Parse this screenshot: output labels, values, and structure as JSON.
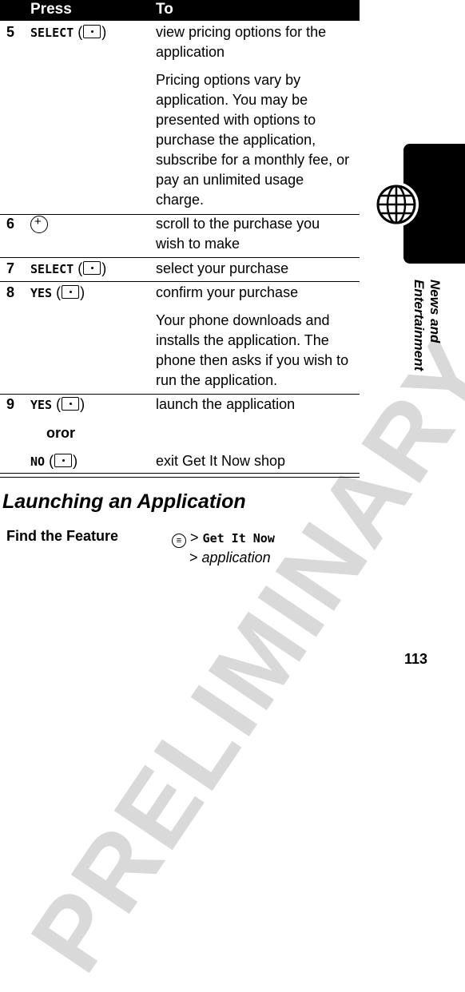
{
  "watermark": "PRELIMINARY",
  "table": {
    "headers": {
      "press": "Press",
      "to": "To"
    },
    "rows": [
      {
        "step": "5",
        "key": "SELECT",
        "key_icon": "left-softkey-icon",
        "to": "view pricing options for the application",
        "note": "Pricing options vary by application. You may be presented with options to purchase the application, subscribe for a monthly fee, or pay an unlimited usage charge."
      },
      {
        "step": "6",
        "key": "",
        "key_icon": "nav-key-icon",
        "to": "scroll to the purchase you wish to make"
      },
      {
        "step": "7",
        "key": "SELECT",
        "key_icon": "left-softkey-icon",
        "to": "select your purchase"
      },
      {
        "step": "8",
        "key": "YES",
        "key_icon": "right-softkey-icon",
        "to": "confirm your purchase",
        "note": "Your phone downloads and installs the application. The phone then asks if you wish to run the application."
      },
      {
        "step": "9",
        "key": "YES",
        "key_icon": "right-softkey-icon",
        "to": "launch the application",
        "or": "oror",
        "alt_key": "NO",
        "alt_key_icon": "left-softkey-icon",
        "alt_to": "exit Get It Now shop"
      }
    ]
  },
  "section": {
    "title": "Launching an Application",
    "find_feature_label": "Find the Feature",
    "menu_icon": "menu-key-icon",
    "path_1": "Get It Now",
    "path_2": "application",
    "separator": ">"
  },
  "side_tab": {
    "label": "News and Entertainment",
    "icon": "globe-icon"
  },
  "page_number": "113"
}
